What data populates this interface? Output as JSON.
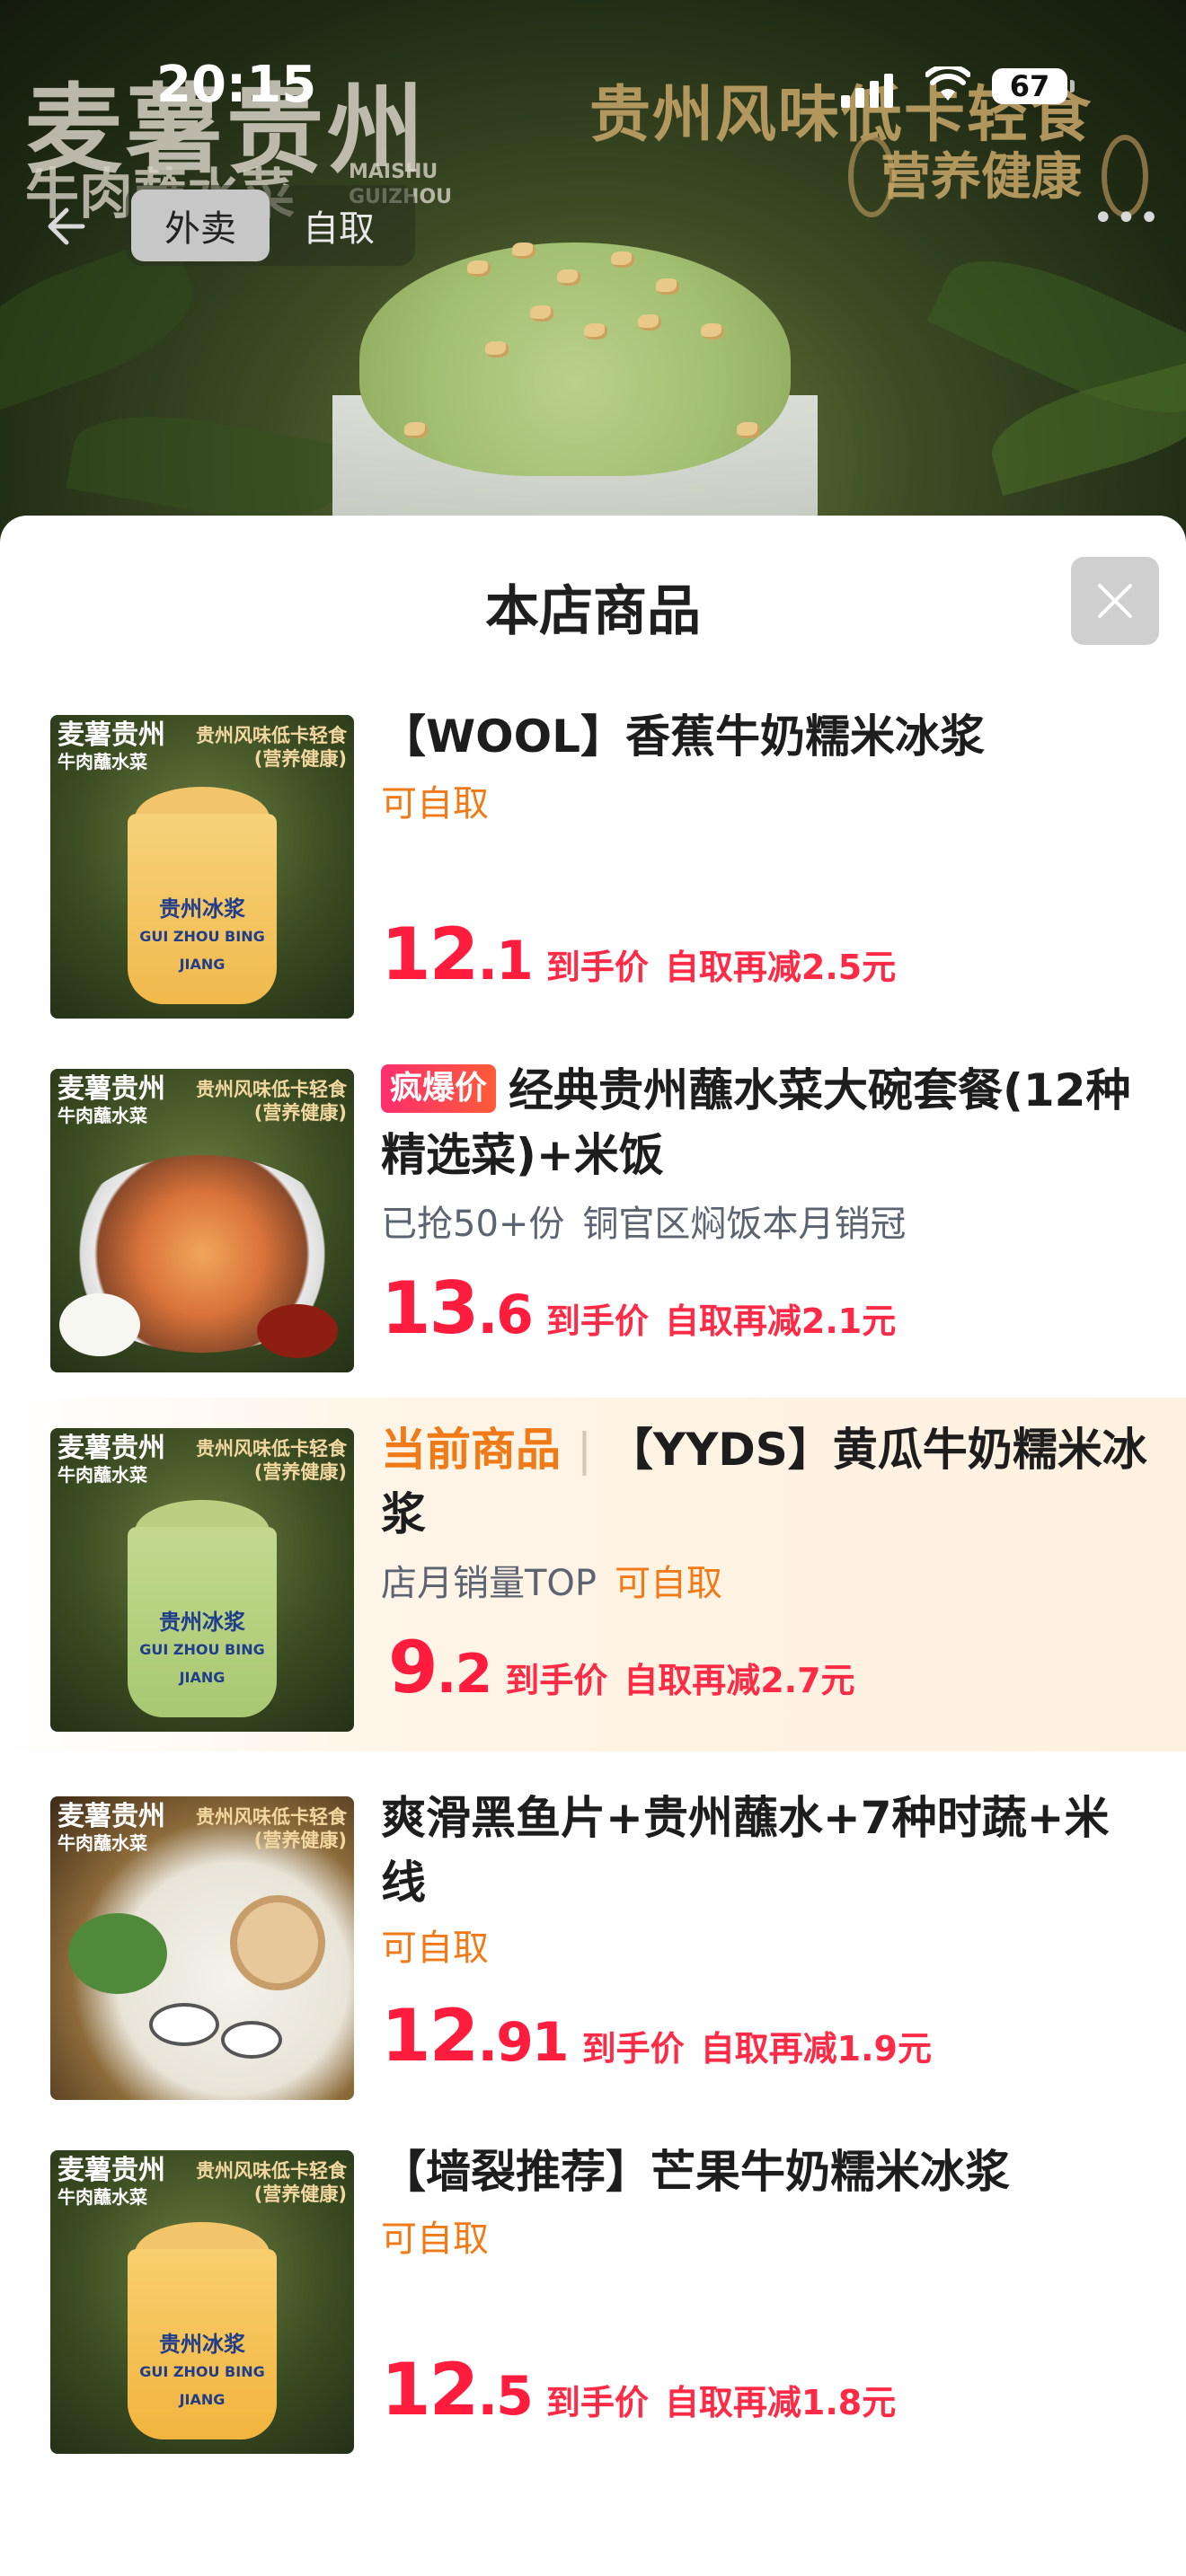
{
  "status_bar": {
    "time": "20:15",
    "battery": "67"
  },
  "hero": {
    "brand_cn": "麦薯贵州",
    "brand_sub": "牛肉蘸水菜",
    "brand_en": "MAISHU GUIZHOU",
    "slogan": "贵州风味低卡轻食",
    "slogan2": "营养健康"
  },
  "mode_switch": {
    "tabs": [
      {
        "label": "外卖",
        "active": true
      },
      {
        "label": "自取",
        "active": false
      }
    ]
  },
  "sheet": {
    "title": "本店商品"
  },
  "thumb_text": {
    "brand": "麦薯贵州",
    "brand_small": "牛肉蘸水菜",
    "slogan_1": "贵州风味低卡轻食",
    "slogan_2": "(营养健康)",
    "cup_label": "贵州冰浆",
    "cup_en": "GUI ZHOU BING JIANG"
  },
  "items": [
    {
      "name": "【WOOL】香蕉牛奶糯米冰浆",
      "sub": [
        "可自取"
      ],
      "price_int": "12",
      "price_dec": ".1",
      "price_tag": "到手价",
      "promo": "自取再减2.5元"
    },
    {
      "badge": "疯爆价",
      "name": "经典贵州蘸水菜大碗套餐(12种精选菜)+米饭",
      "sub": [
        "已抢50+份",
        "铜官区焖饭本月销冠"
      ],
      "price_int": "13",
      "price_dec": ".6",
      "price_tag": "到手价",
      "promo": "自取再减2.1元"
    },
    {
      "current_label": "当前商品",
      "name": "【YYDS】黄瓜牛奶糯米冰浆",
      "sub": [
        "店月销量TOP",
        "可自取"
      ],
      "price_int": "9",
      "price_dec": ".2",
      "price_tag": "到手价",
      "promo": "自取再减2.7元"
    },
    {
      "name": "爽滑黑鱼片+贵州蘸水+7种时蔬+米线",
      "sub": [
        "可自取"
      ],
      "price_int": "12",
      "price_dec": ".91",
      "price_tag": "到手价",
      "promo": "自取再减1.9元"
    },
    {
      "name": "【墙裂推荐】芒果牛奶糯米冰浆",
      "sub": [
        "可自取"
      ],
      "price_int": "12",
      "price_dec": ".5",
      "price_tag": "到手价",
      "promo": "自取再减1.8元"
    }
  ]
}
